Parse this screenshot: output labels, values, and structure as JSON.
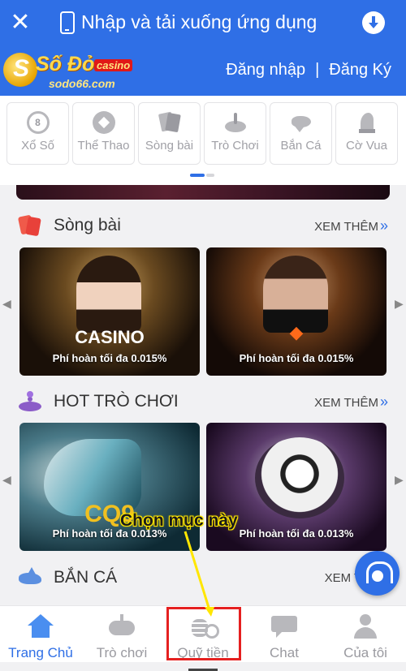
{
  "app_banner": {
    "title": "Nhập và tải xuống ứng dụng"
  },
  "header": {
    "logo": {
      "name": "Số Đỏ",
      "tag": "casino",
      "domain": "sodo66.com"
    },
    "login": "Đăng nhập",
    "separator": "|",
    "register": "Đăng Ký"
  },
  "categories": [
    {
      "label": "Xổ Số",
      "icon": "lottery-ball-icon"
    },
    {
      "label": "Thể Thao",
      "icon": "soccer-ball-icon"
    },
    {
      "label": "Sòng bài",
      "icon": "cards-icon"
    },
    {
      "label": "Trò Chơi",
      "icon": "roulette-icon"
    },
    {
      "label": "Bắn Cá",
      "icon": "fish-icon"
    },
    {
      "label": "Cờ Vua",
      "icon": "chess-knight-icon"
    }
  ],
  "sections": {
    "casino": {
      "title": "Sòng bài",
      "more": "XEM THÊM",
      "cards": [
        {
          "brand": "CASINO",
          "caption": "Phí hoàn tối đa 0.015%"
        },
        {
          "brand": "",
          "caption": "Phí hoàn tối đa 0.015%"
        }
      ]
    },
    "games": {
      "title": "HOT TRÒ CHƠI",
      "more": "XEM THÊM",
      "cards": [
        {
          "brand": "CQ9",
          "caption": "Phí hoàn tối đa 0.013%"
        },
        {
          "brand": "",
          "caption": "Phí hoàn tối đa 0.013%"
        }
      ]
    },
    "fishing": {
      "title": "BẮN CÁ",
      "more": "XEM TH"
    }
  },
  "annotation": {
    "text": "Chọn mục này",
    "color": "#ffe600",
    "box_color": "#e52020"
  },
  "bottom_nav": [
    {
      "label": "Trang Chủ",
      "icon": "home-icon",
      "active": true
    },
    {
      "label": "Trò chơi",
      "icon": "gamepad-icon",
      "active": false
    },
    {
      "label": "Quỹ tiền",
      "icon": "coins-icon",
      "active": false
    },
    {
      "label": "Chat",
      "icon": "chat-icon",
      "active": false
    },
    {
      "label": "Của tôi",
      "icon": "user-icon",
      "active": false
    }
  ],
  "colors": {
    "primary": "#2f6fe6",
    "background": "#f1f1f3"
  }
}
